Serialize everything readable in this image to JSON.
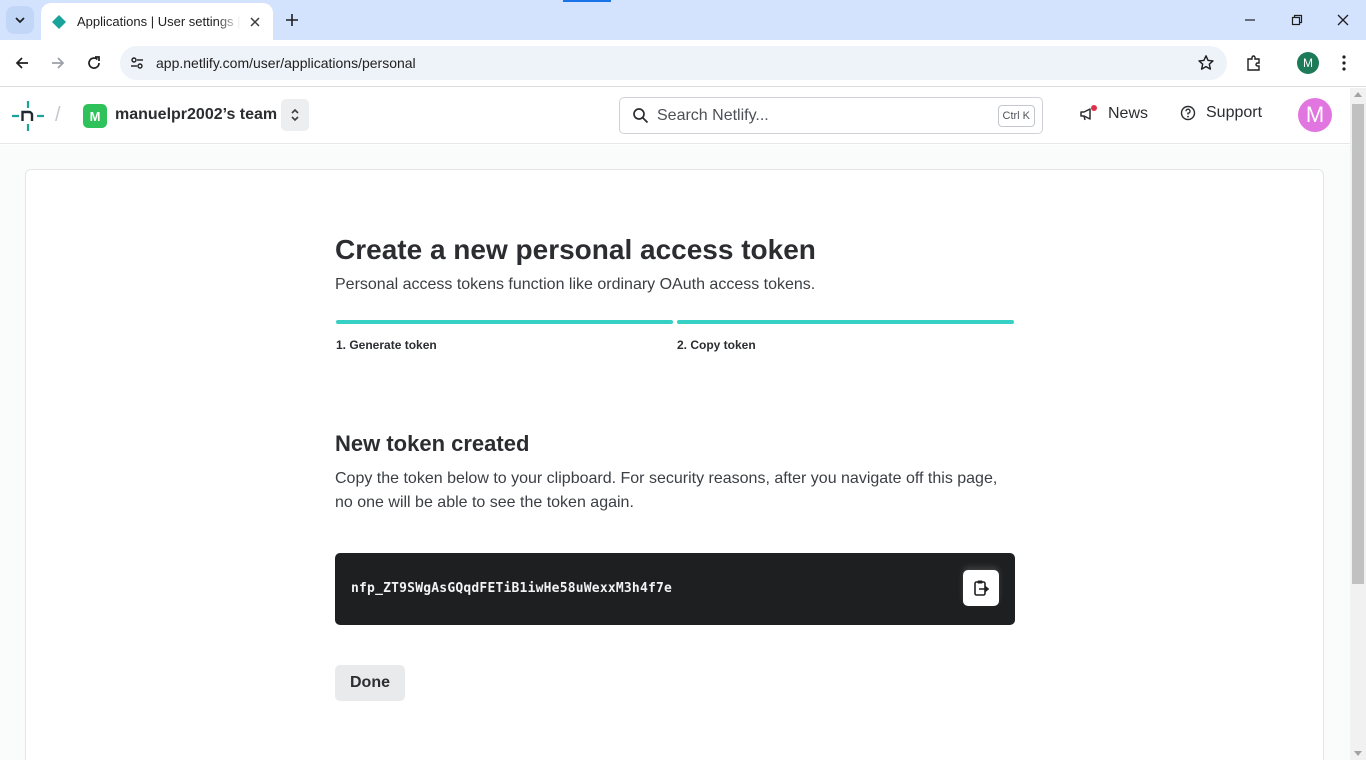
{
  "browser": {
    "tab_title": "Applications | User settings | Netlify",
    "url": "app.netlify.com/user/applications/personal",
    "profile_initial": "M",
    "accent": "#d3e3fd"
  },
  "header": {
    "team_initial": "M",
    "team_name": "manuelpr2002’s team",
    "search_placeholder": "Search Netlify...",
    "search_shortcut": "Ctrl K",
    "news_label": "News",
    "support_label": "Support",
    "user_initial": "M"
  },
  "main": {
    "title": "Create a new personal access token",
    "subtitle": "Personal access tokens function like ordinary OAuth access tokens.",
    "steps": [
      {
        "label": "1. Generate token"
      },
      {
        "label": "2. Copy token"
      }
    ],
    "section_title": "New token created",
    "section_desc": "Copy the token below to your clipboard. For security reasons, after you navigate off this page, no one will be able to see the token again.",
    "token": "nfp_ZT9SWgAsGQqdFETiB1iwHe58uWexxM3h4f7e",
    "done_label": "Done"
  },
  "colors": {
    "step_bar": "#36d0c4",
    "token_bg": "#1e1f21",
    "team_avatar": "#30c25a",
    "user_avatar": "#e276e0"
  }
}
